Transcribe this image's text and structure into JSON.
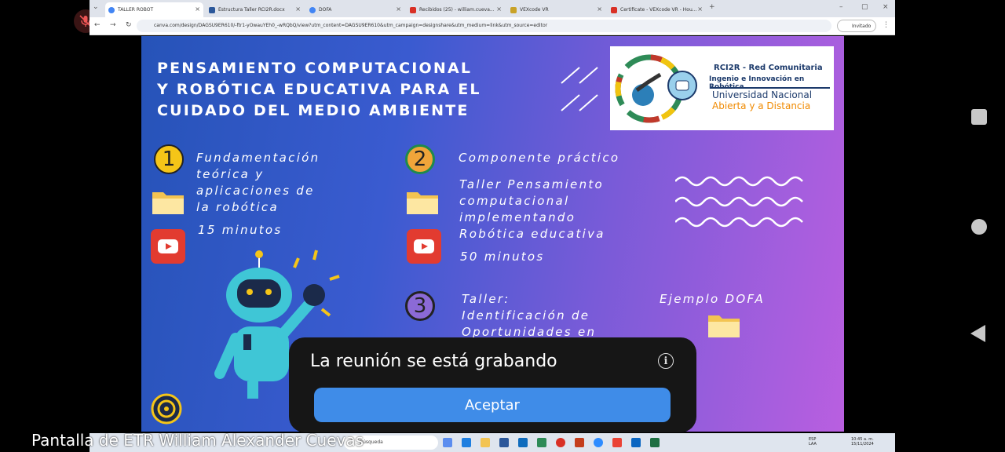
{
  "browser": {
    "tabs": [
      {
        "label": "TALLER ROBOT",
        "color": "#4285f4",
        "active": true
      },
      {
        "label": "Estructura Taller RCI2R.docx",
        "color": "#2b579a"
      },
      {
        "label": "DOFA",
        "color": "#4285f4"
      },
      {
        "label": "Recibidos (25) - william.cueva...",
        "color": "#d93025"
      },
      {
        "label": "VEXcode VR",
        "color": "#c9a227"
      },
      {
        "label": "Certificate - VEXcode VR - Hou...",
        "color": "#d93025"
      }
    ],
    "url": "canva.com/design/DAGSU9ER610/-ftr1-yOwauYEh0_-wRQbQ/view?utm_content=DAGSU9ER610&utm_campaign=designshare&utm_medium=link&utm_source=editor",
    "guest_label": "Invitado"
  },
  "slide": {
    "title_lines": [
      "PENSAMIENTO COMPUTACIONAL",
      "Y ROBÓTICA EDUCATIVA PARA EL",
      "CUIDADO DEL MEDIO AMBIENTE"
    ],
    "logo": {
      "line1": "RCI2R - Red Comunitaria",
      "line2": "Ingenio e Innovación en Robótica",
      "line3": "Universidad Nacional",
      "line4": "Abierta y a Distancia"
    },
    "section1": {
      "number": "1",
      "lines": [
        "Fundamentación",
        "teórica y",
        "aplicaciones de",
        "la robótica"
      ],
      "duration": "15 minutos"
    },
    "section2": {
      "number": "2",
      "heading": "Componente práctico",
      "lines": [
        "Taller Pensamiento",
        "computacional",
        "implementando",
        "Robótica educativa"
      ],
      "duration": "50 minutos"
    },
    "section3": {
      "number": "3",
      "lines": [
        "Taller:",
        "Identificación de",
        "Oportunidades en"
      ]
    },
    "dofa_example": "Ejemplo DOFA"
  },
  "dialog": {
    "message": "La reunión se está grabando",
    "accept_label": "Aceptar"
  },
  "taskbar": {
    "search_placeholder": "Búsqueda",
    "lang_top": "ESP",
    "lang_bottom": "LAA",
    "time": "10:45 a. m.",
    "date": "15/11/2024"
  },
  "sharer_caption": "Pantalla de ETR William Alexander Cuevas"
}
